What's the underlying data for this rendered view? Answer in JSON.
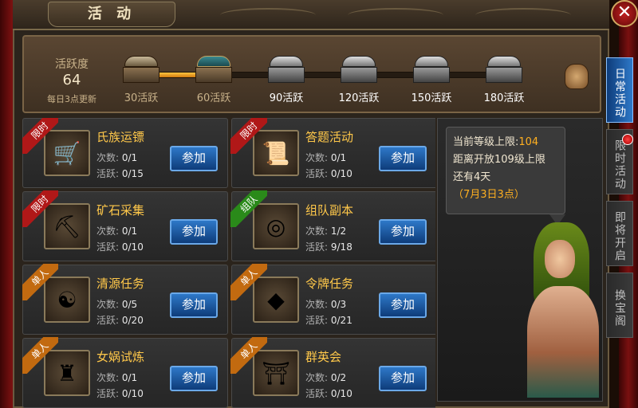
{
  "window": {
    "title": "活 动",
    "close_glyph": "✕"
  },
  "activity": {
    "label": "活跃度",
    "value": "64",
    "note": "每日3点更新",
    "progress_fraction": 0.2,
    "rewards": [
      {
        "label": "30活跃",
        "state": "claimed"
      },
      {
        "label": "60活跃",
        "state": "open"
      },
      {
        "label": "90活跃",
        "state": "locked"
      },
      {
        "label": "120活跃",
        "state": "locked"
      },
      {
        "label": "150活跃",
        "state": "locked"
      },
      {
        "label": "180活跃",
        "state": "locked"
      }
    ],
    "bag_icon": "bag-icon"
  },
  "cards": [
    {
      "tag": "限时",
      "tag_color": "red",
      "name": "氏族运镖",
      "count_label": "次数:",
      "count": "0/1",
      "act_label": "活跃:",
      "act": "0/15",
      "button": "参加",
      "icon": "cart-icon"
    },
    {
      "tag": "限时",
      "tag_color": "red",
      "name": "答题活动",
      "count_label": "次数:",
      "count": "0/1",
      "act_label": "活跃:",
      "act": "0/10",
      "button": "参加",
      "icon": "scroll-icon"
    },
    {
      "tag": "限时",
      "tag_color": "red",
      "name": "矿石采集",
      "count_label": "次数:",
      "count": "0/1",
      "act_label": "活跃:",
      "act": "0/10",
      "button": "参加",
      "icon": "ore-icon"
    },
    {
      "tag": "组队",
      "tag_color": "green",
      "name": "组队副本",
      "count_label": "次数:",
      "count": "1/2",
      "act_label": "活跃:",
      "act": "9/18",
      "button": "参加",
      "icon": "portal-icon"
    },
    {
      "tag": "单人",
      "tag_color": "orange",
      "name": "清源任务",
      "count_label": "次数:",
      "count": "0/5",
      "act_label": "活跃:",
      "act": "0/20",
      "button": "参加",
      "icon": "elder-icon"
    },
    {
      "tag": "单人",
      "tag_color": "orange",
      "name": "令牌任务",
      "count_label": "次数:",
      "count": "0/3",
      "act_label": "活跃:",
      "act": "0/21",
      "button": "参加",
      "icon": "token-icon"
    },
    {
      "tag": "单人",
      "tag_color": "orange",
      "name": "女娲试炼",
      "count_label": "次数:",
      "count": "0/1",
      "act_label": "活跃:",
      "act": "0/10",
      "button": "参加",
      "icon": "statue-icon"
    },
    {
      "tag": "单人",
      "tag_color": "orange",
      "name": "群英会",
      "count_label": "次数:",
      "count": "0/2",
      "act_label": "活跃:",
      "act": "0/10",
      "button": "参加",
      "icon": "gate-icon"
    }
  ],
  "npc": {
    "line1_prefix": "当前等级上限:",
    "line1_value": "104",
    "line2": "距离开放109级上限",
    "line3": "还有4天",
    "line4": "（7月3日3点）"
  },
  "side_tabs": [
    {
      "label": "日常活动",
      "active": true
    },
    {
      "label": "限时活动",
      "active": false,
      "has_dot": true
    },
    {
      "label": "即将开启",
      "active": false
    },
    {
      "label": "换宝阁",
      "active": false
    }
  ]
}
